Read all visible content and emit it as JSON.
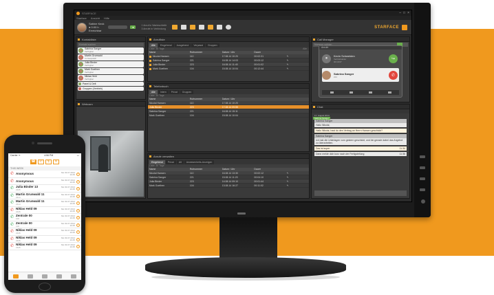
{
  "app": {
    "logo_text": "STARFACE",
    "menu": [
      "Starface",
      "Ansicht",
      "Hilfe"
    ],
    "user_name": "Sabine Keck",
    "user_lines": [
      "● 0:00 h",
      "Erreichbar"
    ],
    "green_label": "●",
    "calls_lines": [
      "1 Anruf in Warteschleife",
      "3 Anrufe in Verbindung"
    ],
    "window_controls": [
      "–",
      "□",
      "×"
    ]
  },
  "contacts_panel": {
    "title": "Kontaktliste",
    "search_placeholder": "Kontakt suchen",
    "contacts": [
      {
        "name": "Sabrina Sanger",
        "sub": "Verfügbar"
      },
      {
        "name": "Martin Grunwald",
        "sub": "Im Gespräch"
      },
      {
        "name": "Julia Binder",
        "sub": "Verfügbar"
      },
      {
        "name": "Mark Goethen",
        "sub": "Verfügbar"
      },
      {
        "name": "Niklas Held",
        "sub": "Verfügbar"
      }
    ],
    "groups": [
      "Panel & Delt",
      "Gruppen (Vertrieb)"
    ]
  },
  "video_panel": {
    "title": "Webcam"
  },
  "history_panel": {
    "title": "Anrufliste",
    "tabs": [
      "Alle",
      "Eingehend",
      "Ausgehend",
      "Verpasst",
      "Gruppen"
    ],
    "filter": "Liste: 30 Tage",
    "filter_right": "Alle",
    "columns": [
      "Name",
      "Rufnummer",
      "Datum / Uhr",
      "Dauer",
      ""
    ],
    "rows": [
      [
        "Nicolai Hansen",
        "110",
        "17.08.14 10:20",
        "00:02:31",
        "↰"
      ],
      [
        "Sabrina Sanger",
        "221",
        "16.08.14 14:03",
        "00:03:12",
        "↰"
      ],
      [
        "Julia Binder",
        "223",
        "16.08.14 11:40",
        "00:01:02",
        "↰"
      ],
      [
        "Mark Goethen",
        "104",
        "15.08.14 10:04",
        "00:12:44",
        "↰"
      ]
    ]
  },
  "phonebook_panel": {
    "title": "Telefonbuch",
    "tabs": [
      "Alle",
      "Intern",
      "Privat",
      "Gruppen"
    ],
    "filter": "Liste: 30 Tage",
    "columns": [
      "Name",
      "Rufnummer",
      "Datum / Uhr",
      "",
      ""
    ],
    "rows": [
      [
        "Nicolai Hansen",
        "110",
        "17.08.14 10:20",
        "",
        ""
      ],
      [
        "Julia Binder",
        "223",
        "17.08.14 09:55",
        "",
        ""
      ],
      [
        "Sabrina Sanger",
        "221",
        "16.08.14 15:11",
        "",
        ""
      ],
      [
        "Mark Goethen",
        "104",
        "15.08.14 10:04",
        "",
        ""
      ]
    ],
    "selected_index": 1
  },
  "log_panel": {
    "title": "Anrufe verwalten",
    "tabs": [
      "Eingehend",
      "Privat",
      "Alt",
      "Anwesenheits-Anzeigen"
    ],
    "filter": "Liste: 30 Tage",
    "columns": [
      "Name",
      "Rufnummer",
      "Datum / Uhr",
      "Dauer",
      ""
    ],
    "rows": [
      [
        "Nicolai Hansen",
        "110",
        "16.08.14 13:30",
        "00:02:12",
        "↰"
      ],
      [
        "Sabrina Sanger",
        "221",
        "15.08.14 11:20",
        "00:04:10",
        "↰"
      ],
      [
        "Julia Binder",
        "223",
        "14.08.14 09:10",
        "00:01:44",
        "↰"
      ],
      [
        "Mark Goethen",
        "104",
        "13.08.14 16:27",
        "00:11:02",
        "↰"
      ]
    ]
  },
  "call_panel": {
    "title": "Call Manager",
    "search_placeholder": "Nummer wählen",
    "card_title": "Anrufe",
    "active_name": "Kevin Schweiden",
    "active_sub": "Vertriebsleiter",
    "active_time": "00:10:07",
    "incoming_name": "Sabrina Sanger",
    "incoming_sub": "221"
  },
  "chat_panel": {
    "title": "Chat",
    "tab": "Sabrina Sanger",
    "date": "17. August 2014",
    "messages": [
      {
        "from": "Sabrina Sanger",
        "text": "Hallo Nikolai,",
        "mine": false
      },
      {
        "from": "",
        "text": "Hallo Nikolai, hast du den Vertrag an Herrn Hansen geschickt?",
        "mine": true
      },
      {
        "from": "Sabrina Sanger",
        "text": "Ich hab die Unterlagen vom gestern geschickt, und bin gerade dabei das Angebot zu überarbeiten.",
        "mine": false
      },
      {
        "from": "",
        "text": "Das ist super",
        "mine": true,
        "time": "11:34"
      },
      {
        "from": "",
        "text": "Dann melde dich kurz nach der Fertigstellung",
        "mine": false,
        "time": "11:36"
      }
    ]
  },
  "phone": {
    "carrier": "Carrier ᯤ",
    "time": "4:56 PM",
    "battery": "▭",
    "section": "THIS WEEK",
    "segments": [
      "☎",
      "✆",
      "↯",
      "✕"
    ],
    "entries": [
      {
        "name": "Anonymous",
        "num": "",
        "date": "Mo 03.07.2014",
        "time": "10:45",
        "missed": true
      },
      {
        "name": "Anonymous",
        "num": "",
        "date": "Mo 03.07.2014",
        "time": "10:45",
        "missed": true
      },
      {
        "name": "Julia Binder 13",
        "num": "2345",
        "date": "Mo 03.07.2014",
        "time": "10:45",
        "missed": false
      },
      {
        "name": "Martin Grunwald 11",
        "num": "2314",
        "date": "Mo 03.07.2014",
        "time": "10:45",
        "missed": false
      },
      {
        "name": "Martin Grunwald 11",
        "num": "2314",
        "date": "Mo 03.07.2014",
        "time": "10:45",
        "missed": false
      },
      {
        "name": "Niklas Held 09",
        "num": "2345",
        "date": "Mo 03.07.2014",
        "time": "10:45",
        "missed": true
      },
      {
        "name": "Zentrale 00",
        "num": "100",
        "date": "Mo 03.07.2014",
        "time": "10:45",
        "missed": false
      },
      {
        "name": "Zentrale 00",
        "num": "100",
        "date": "Mo 03.07.2014",
        "time": "10:45",
        "missed": false
      },
      {
        "name": "Niklas Held 09",
        "num": "2345",
        "date": "Mo 03.07.2014",
        "time": "10:45",
        "missed": true
      },
      {
        "name": "Niklas Held 09",
        "num": "2345",
        "date": "Mo 03.07.2014",
        "time": "10:45",
        "missed": true
      },
      {
        "name": "Niklas Held 09",
        "num": "2345",
        "date": "Mo 03.07.2014",
        "time": "10:45",
        "missed": true
      }
    ]
  },
  "colors": {
    "orange": "#f0991e",
    "green": "#3aa655",
    "red": "#e2453c"
  }
}
